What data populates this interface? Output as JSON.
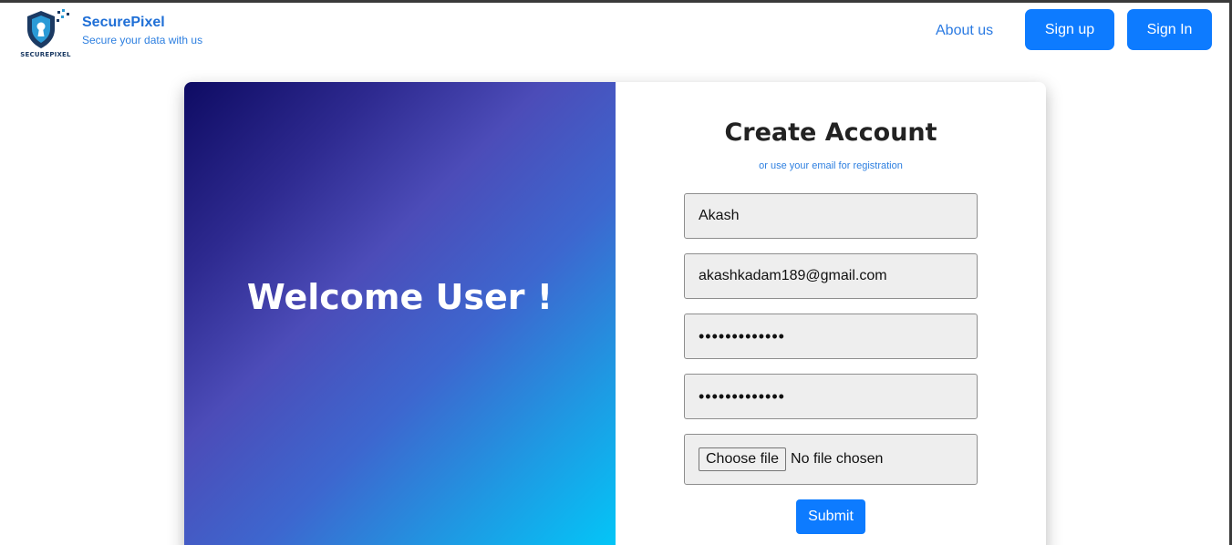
{
  "brand": {
    "logo_icon": "shield-keyhole-icon",
    "logo_text": "SECUREPIXEL",
    "name": "SecurePixel",
    "tagline": "Secure your data with us"
  },
  "nav": {
    "about_label": "About us",
    "signup_label": "Sign up",
    "signin_label": "Sign In"
  },
  "hero": {
    "welcome_text": "Welcome User !"
  },
  "form": {
    "title": "Create Account",
    "subtitle": "or use your email for registration",
    "name_value": "Akash",
    "email_value": "akashkadam189@gmail.com",
    "password_value": "•••••••••••••",
    "confirm_password_value": "•••••••••••••",
    "file_button_label": "Choose file",
    "file_status": "No file chosen",
    "submit_label": "Submit"
  },
  "colors": {
    "primary": "#0d7bff",
    "link": "#2a7ae2",
    "gradient_start": "#0e0b63",
    "gradient_mid": "#4c4cb8",
    "gradient_end": "#02c8f8"
  }
}
